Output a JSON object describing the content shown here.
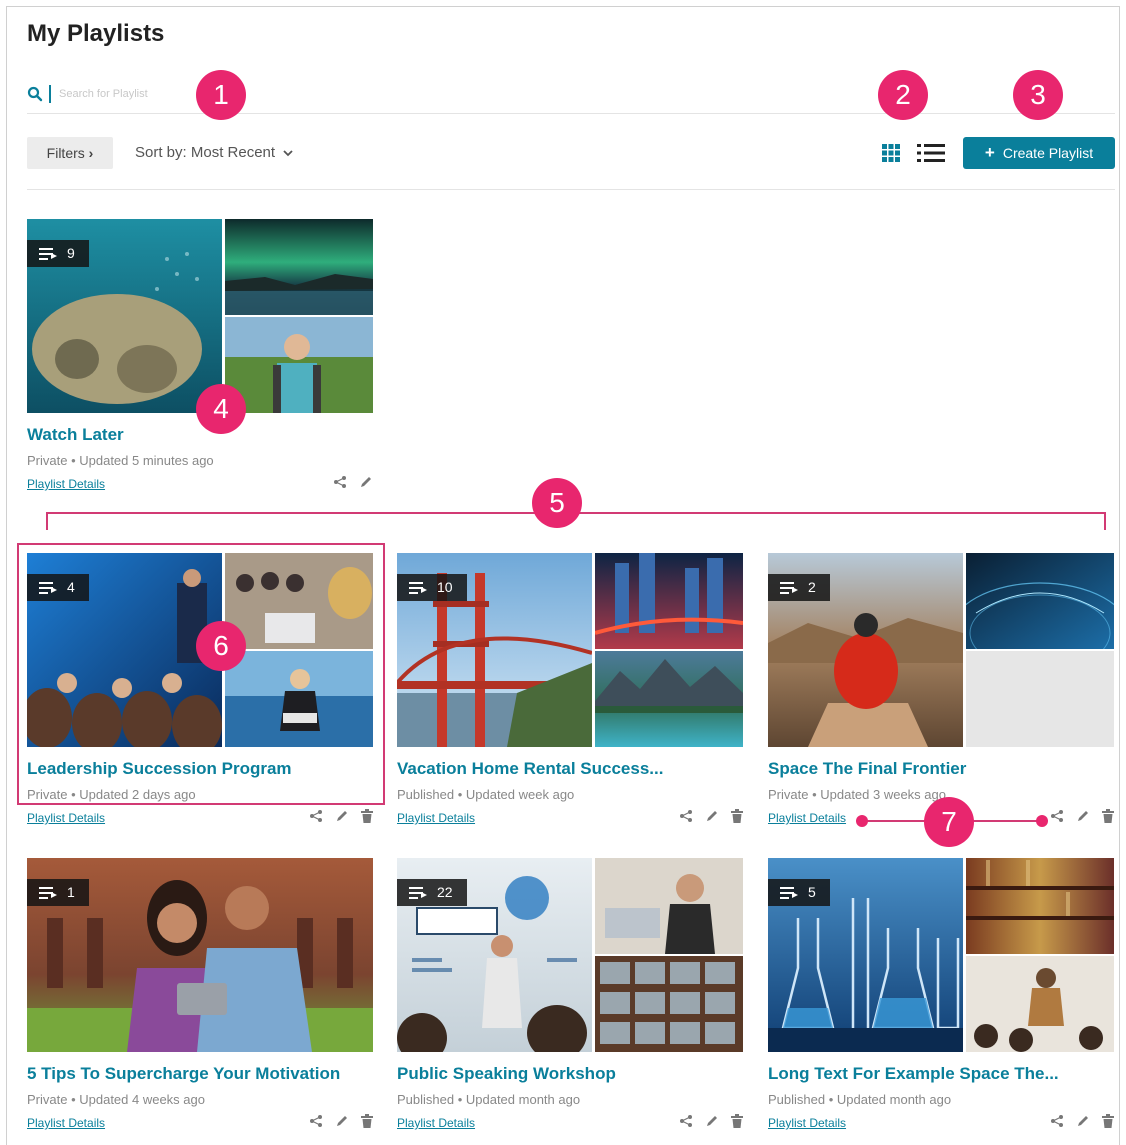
{
  "page": {
    "title": "My Playlists"
  },
  "search": {
    "placeholder": "Search for Playlist"
  },
  "toolbar": {
    "filters_label": "Filters",
    "sort_label": "Sort by: Most Recent",
    "create_label": "Create Playlist"
  },
  "colors": {
    "accent": "#0a7f9b",
    "annotation": "#e8266e"
  },
  "icons": [
    "search-icon",
    "grid-view-icon",
    "list-view-icon",
    "plus-icon",
    "playlist-icon",
    "share-icon",
    "edit-icon",
    "trash-icon",
    "chevron-right-icon",
    "chevron-down-icon"
  ],
  "callouts": [
    "1",
    "2",
    "3",
    "4",
    "5",
    "6",
    "7"
  ],
  "details_label": "Playlist Details",
  "watch_later": {
    "title": "Watch Later",
    "count": "9",
    "meta": "Private • Updated 5 minutes ago"
  },
  "playlists": [
    {
      "title": "Leadership Succession Program",
      "count": "4",
      "meta": "Private • Updated 2 days ago"
    },
    {
      "title": "Vacation Home Rental Success...",
      "count": "10",
      "meta": "Published • Updated week ago"
    },
    {
      "title": "Space The Final Frontier",
      "count": "2",
      "meta": "Private • Updated 3 weeks ago"
    },
    {
      "title": "5 Tips To Supercharge Your Motivation",
      "count": "1",
      "meta": "Private • Updated 4 weeks ago"
    },
    {
      "title": "Public Speaking Workshop",
      "count": "22",
      "meta": "Published • Updated month ago"
    },
    {
      "title": "Long Text For Example Space The...",
      "count": "5",
      "meta": "Published • Updated month ago"
    }
  ]
}
